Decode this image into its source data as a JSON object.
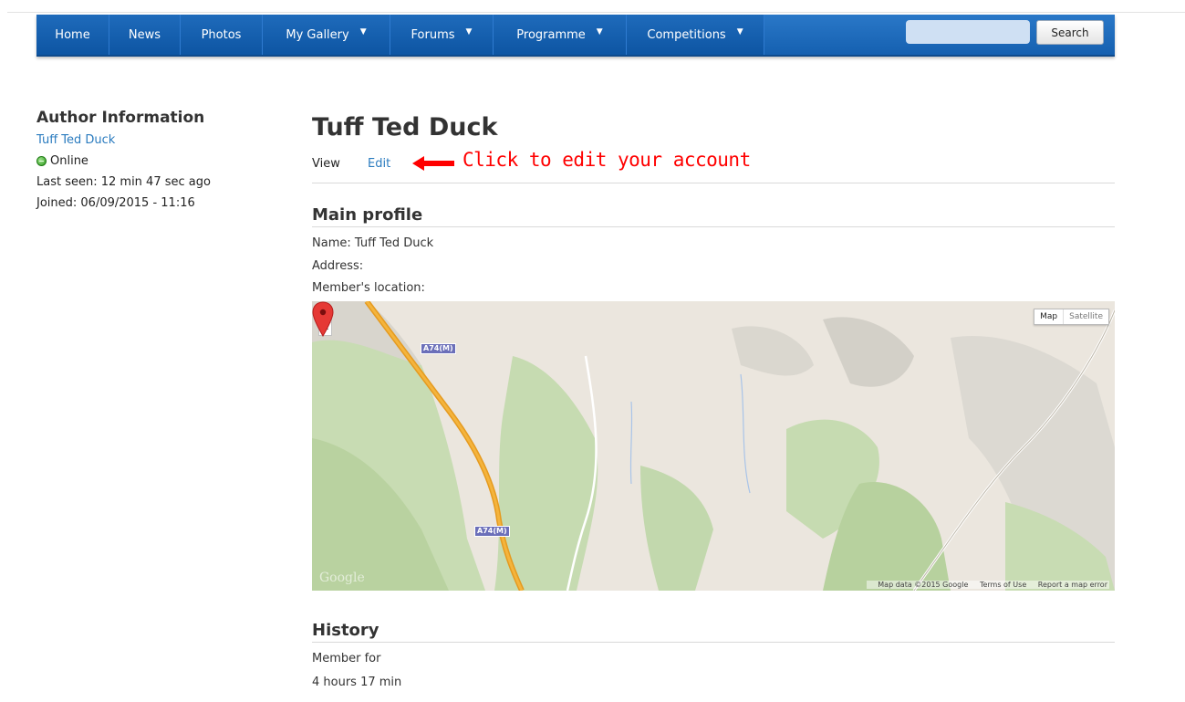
{
  "nav": {
    "items": [
      {
        "label": "Home",
        "dropdown": false
      },
      {
        "label": "News",
        "dropdown": false
      },
      {
        "label": "Photos",
        "dropdown": false
      },
      {
        "label": "My Gallery",
        "dropdown": true
      },
      {
        "label": "Forums",
        "dropdown": true
      },
      {
        "label": "Programme",
        "dropdown": true
      },
      {
        "label": "Competitions",
        "dropdown": true
      }
    ],
    "search_placeholder": "",
    "search_label": "Search",
    "bar_color": "#1a66b6"
  },
  "sidebar": {
    "heading": "Author Information",
    "author_name": "Tuff Ted Duck",
    "status": "Online",
    "last_seen": "Last seen: 12 min 47 sec ago",
    "joined": "Joined: 06/09/2015 - 11:16"
  },
  "main": {
    "title": "Tuff Ted Duck",
    "tabs": {
      "view": "View",
      "edit": "Edit"
    },
    "annotation": "Click to edit your account",
    "annotation_color": "#ff0000",
    "profile": {
      "heading": "Main profile",
      "name": "Name: Tuff Ted Duck",
      "address": "Address:",
      "location": "Member's location:"
    },
    "map": {
      "zoom_in": "+",
      "zoom_out": "−",
      "type_map": "Map",
      "type_satellite": "Satellite",
      "road_label_1": "A74(M)",
      "road_label_2": "A74(M)",
      "logo": "Google",
      "attribution": {
        "data": "Map data ©2015 Google",
        "terms": "Terms of Use",
        "report": "Report a map error"
      }
    },
    "history": {
      "heading": "History",
      "member_for_label": "Member for",
      "member_for_value": "4 hours 17 min"
    }
  }
}
